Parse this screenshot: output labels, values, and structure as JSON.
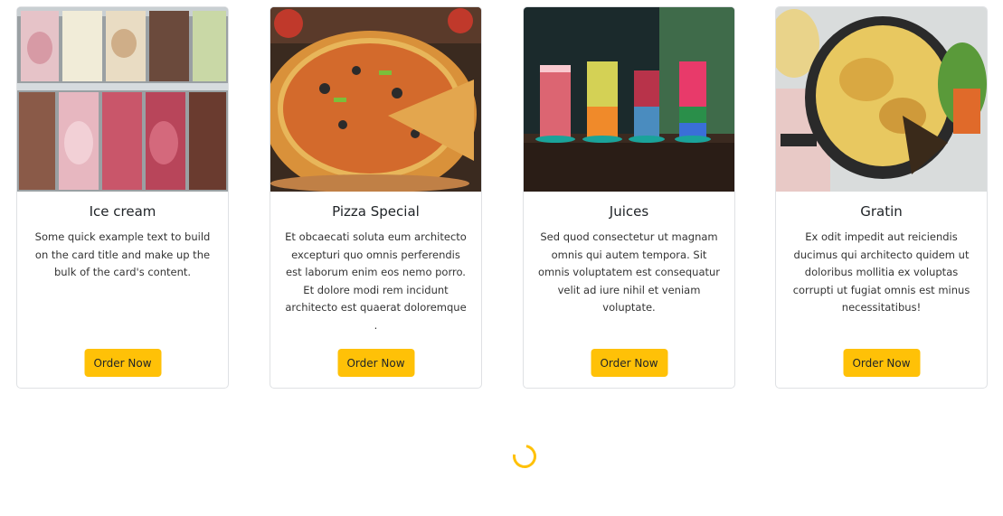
{
  "theme": {
    "accent": "#ffc107",
    "card_border": "#dfe1e4"
  },
  "cards": [
    {
      "title": "Ice cream",
      "text": "Some quick example text to build on the card title and make up the bulk of the card's content.",
      "button": "Order Now",
      "image_icon": "ice-cream-image"
    },
    {
      "title": "Pizza Special",
      "text": "Et obcaecati soluta eum architecto excepturi quo omnis perferendis est laborum enim eos nemo porro. Et dolore modi rem incidunt architecto est quaerat doloremque .",
      "button": "Order Now",
      "image_icon": "pizza-image"
    },
    {
      "title": "Juices",
      "text": "Sed quod consectetur ut magnam omnis qui autem tempora. Sit omnis voluptatem est consequatur velit ad iure nihil et veniam voluptate.",
      "button": "Order Now",
      "image_icon": "juices-image"
    },
    {
      "title": "Gratin",
      "text": "Ex odit impedit aut reiciendis ducimus qui architecto quidem ut doloribus mollitia ex voluptas corrupti ut fugiat omnis est minus necessitatibus!",
      "button": "Order Now",
      "image_icon": "gratin-image"
    }
  ],
  "loader": {
    "icon": "spinner-icon"
  }
}
